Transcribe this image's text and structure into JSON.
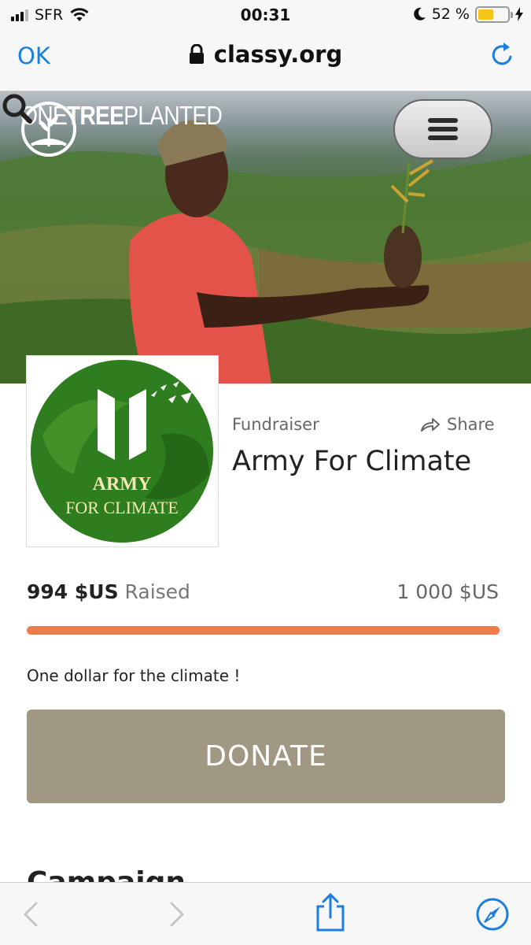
{
  "status_bar": {
    "carrier": "SFR",
    "time": "00:31",
    "battery_percent": "52 %",
    "battery_level": 0.52,
    "icons": [
      "signal-icon",
      "wifi-icon",
      "moon-icon",
      "battery-icon",
      "charging-icon"
    ]
  },
  "browser": {
    "ok_label": "OK",
    "url": "classy.org",
    "icons": [
      "lock-icon",
      "reload-icon",
      "back-icon",
      "forward-icon",
      "share-icon",
      "compass-icon"
    ]
  },
  "site_header": {
    "brand_part1": "ONE",
    "brand_part2": "TREE",
    "brand_part3": "PLANTED",
    "icons": [
      "tree-logo-icon",
      "search-icon",
      "hamburger-menu-icon"
    ]
  },
  "logo_card": {
    "line1": "ARMY",
    "line2": "FOR CLIMATE"
  },
  "fundraiser": {
    "type_label": "Fundraiser",
    "share_label": "Share",
    "title": "Army For Climate",
    "raised_amount": "994 $US",
    "raised_word": "Raised",
    "goal": "1 000 $US",
    "progress_fraction": 0.994,
    "description": "One dollar for the climate !",
    "donate_label": "DONATE",
    "next_section_heading": "Campaign"
  },
  "colors": {
    "ios_blue": "#1a7fe0",
    "progress": "#ec7d4a",
    "donate": "#a09883",
    "logo_green": "#2e7d1f"
  }
}
